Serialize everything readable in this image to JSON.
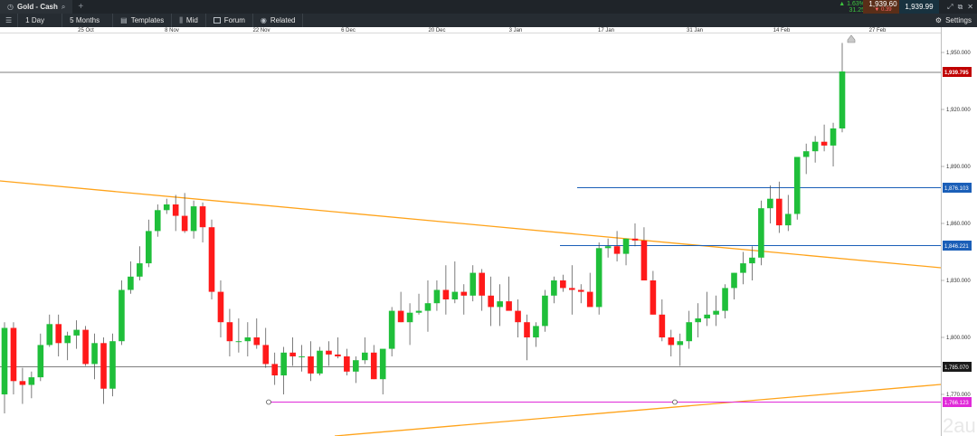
{
  "instrument_tab": {
    "title": "Gold - Cash",
    "icon": "search-icon"
  },
  "add_tab_label": "+",
  "quote": {
    "change_pct": "▲ 1.63%",
    "change_pts": "31.25",
    "bid": "1,939.60",
    "spread": "▼ 0.39",
    "ask": "1,939.99"
  },
  "toolbar": {
    "interval": "1 Day",
    "range": "5 Months",
    "templates": "Templates",
    "price_type": "Mid",
    "forum": "Forum",
    "related": "Related",
    "settings": "Settings"
  },
  "date_axis": [
    "25 Oct",
    "8 Nov",
    "22 Nov",
    "6 Dec",
    "20 Dec",
    "3 Jan",
    "17 Jan",
    "31 Jan",
    "14 Feb",
    "27 Feb"
  ],
  "price_axis": [
    "1,950.000",
    "1,920.000",
    "1,890.000",
    "1,860.000",
    "1,830.000",
    "1,800.000",
    "1,770.000"
  ],
  "price_labels": {
    "current": "1,939.795",
    "blue_upper": "1,876.103",
    "blue_lower": "1,846.221",
    "support": "1,785.070",
    "magenta": "1,766.123"
  },
  "watermark": "2au",
  "colors": {
    "up": "#1fbf3a",
    "down": "#ff1a1a",
    "trend": "#ffa31a",
    "blue": "#1b5fb8",
    "magenta": "#e02ad9",
    "current": "#c00000"
  },
  "chart_data": {
    "type": "candlestick",
    "y_axis_range": [
      1760,
      1960
    ],
    "candles": [
      [
        1770,
        1808,
        1760,
        1805
      ],
      [
        1805,
        1808,
        1770,
        1777
      ],
      [
        1777,
        1784,
        1765,
        1775
      ],
      [
        1775,
        1782,
        1768,
        1779
      ],
      [
        1779,
        1802,
        1777,
        1796
      ],
      [
        1796,
        1812,
        1795,
        1807
      ],
      [
        1807,
        1812,
        1790,
        1797
      ],
      [
        1797,
        1803,
        1788,
        1801
      ],
      [
        1801,
        1809,
        1794,
        1804
      ],
      [
        1804,
        1806,
        1785,
        1786
      ],
      [
        1786,
        1802,
        1778,
        1797
      ],
      [
        1797,
        1800,
        1765,
        1773
      ],
      [
        1773,
        1802,
        1769,
        1798
      ],
      [
        1798,
        1830,
        1796,
        1825
      ],
      [
        1825,
        1840,
        1823,
        1832
      ],
      [
        1832,
        1848,
        1830,
        1839
      ],
      [
        1839,
        1862,
        1837,
        1856
      ],
      [
        1856,
        1870,
        1853,
        1867
      ],
      [
        1867,
        1873,
        1865,
        1870
      ],
      [
        1870,
        1875,
        1856,
        1864
      ],
      [
        1864,
        1876,
        1855,
        1856
      ],
      [
        1856,
        1872,
        1852,
        1869
      ],
      [
        1869,
        1871,
        1850,
        1858
      ],
      [
        1858,
        1862,
        1820,
        1824
      ],
      [
        1824,
        1830,
        1800,
        1808
      ],
      [
        1808,
        1815,
        1790,
        1798
      ],
      [
        1798,
        1810,
        1792,
        1798
      ],
      [
        1798,
        1808,
        1790,
        1800
      ],
      [
        1800,
        1810,
        1794,
        1796
      ],
      [
        1796,
        1805,
        1784,
        1786
      ],
      [
        1786,
        1792,
        1775,
        1780
      ],
      [
        1780,
        1795,
        1770,
        1792
      ],
      [
        1792,
        1800,
        1785,
        1790
      ],
      [
        1790,
        1796,
        1782,
        1790
      ],
      [
        1790,
        1798,
        1777,
        1781
      ],
      [
        1781,
        1795,
        1780,
        1793
      ],
      [
        1793,
        1798,
        1785,
        1791
      ],
      [
        1791,
        1800,
        1789,
        1790
      ],
      [
        1790,
        1794,
        1780,
        1782
      ],
      [
        1782,
        1790,
        1776,
        1788
      ],
      [
        1788,
        1800,
        1786,
        1792
      ],
      [
        1792,
        1796,
        1778,
        1778
      ],
      [
        1778,
        1790,
        1770,
        1794
      ],
      [
        1794,
        1816,
        1790,
        1814
      ],
      [
        1814,
        1824,
        1808,
        1808
      ],
      [
        1808,
        1818,
        1796,
        1813
      ],
      [
        1813,
        1823,
        1812,
        1814
      ],
      [
        1814,
        1830,
        1803,
        1818
      ],
      [
        1818,
        1830,
        1814,
        1825
      ],
      [
        1825,
        1838,
        1812,
        1820
      ],
      [
        1820,
        1840,
        1818,
        1824
      ],
      [
        1824,
        1828,
        1812,
        1822
      ],
      [
        1822,
        1838,
        1819,
        1834
      ],
      [
        1834,
        1836,
        1814,
        1822
      ],
      [
        1822,
        1832,
        1806,
        1816
      ],
      [
        1816,
        1828,
        1806,
        1819
      ],
      [
        1819,
        1832,
        1815,
        1814
      ],
      [
        1814,
        1820,
        1800,
        1808
      ],
      [
        1808,
        1812,
        1788,
        1800
      ],
      [
        1800,
        1808,
        1795,
        1806
      ],
      [
        1806,
        1825,
        1803,
        1822
      ],
      [
        1822,
        1832,
        1818,
        1830
      ],
      [
        1830,
        1833,
        1824,
        1826
      ],
      [
        1826,
        1838,
        1812,
        1825
      ],
      [
        1825,
        1828,
        1818,
        1824
      ],
      [
        1824,
        1834,
        1818,
        1816
      ],
      [
        1816,
        1850,
        1812,
        1847
      ],
      [
        1847,
        1852,
        1842,
        1848
      ],
      [
        1848,
        1856,
        1840,
        1844
      ],
      [
        1844,
        1852,
        1838,
        1852
      ],
      [
        1852,
        1860,
        1848,
        1851
      ],
      [
        1851,
        1858,
        1835,
        1830
      ],
      [
        1830,
        1835,
        1812,
        1812
      ],
      [
        1812,
        1820,
        1798,
        1800
      ],
      [
        1800,
        1804,
        1790,
        1796
      ],
      [
        1796,
        1802,
        1785,
        1798
      ],
      [
        1798,
        1814,
        1794,
        1808
      ],
      [
        1808,
        1818,
        1800,
        1810
      ],
      [
        1810,
        1824,
        1806,
        1812
      ],
      [
        1812,
        1822,
        1806,
        1814
      ],
      [
        1814,
        1828,
        1810,
        1826
      ],
      [
        1826,
        1834,
        1820,
        1834
      ],
      [
        1834,
        1845,
        1828,
        1839
      ],
      [
        1839,
        1848,
        1830,
        1842
      ],
      [
        1842,
        1872,
        1838,
        1868
      ],
      [
        1868,
        1880,
        1860,
        1873
      ],
      [
        1873,
        1882,
        1855,
        1859
      ],
      [
        1859,
        1875,
        1856,
        1865
      ],
      [
        1865,
        1895,
        1862,
        1895
      ],
      [
        1895,
        1902,
        1886,
        1898
      ],
      [
        1898,
        1906,
        1892,
        1903
      ],
      [
        1903,
        1912,
        1898,
        1901
      ],
      [
        1901,
        1913,
        1890,
        1910
      ],
      [
        1910,
        1955,
        1908,
        1940
      ]
    ]
  }
}
